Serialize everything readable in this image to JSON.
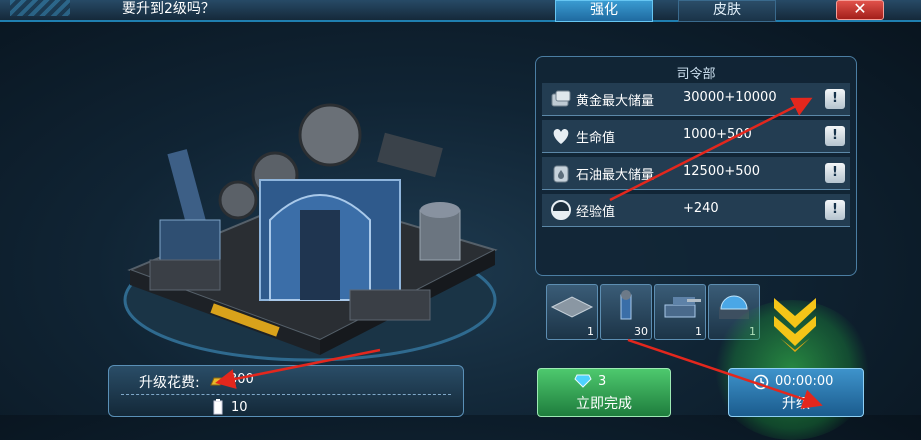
{
  "header": {
    "title": "要升到2级吗？",
    "tabs": [
      {
        "label": "强化",
        "active": true
      },
      {
        "label": "皮肤",
        "active": false
      }
    ],
    "close_icon": "close-x-icon"
  },
  "stats": {
    "panel_title": "司令部",
    "rows": [
      {
        "icon": "gold-storage-icon",
        "name": "黄金最大储量",
        "value": "30000+10000"
      },
      {
        "icon": "heart-icon",
        "name": "生命值",
        "value": "1000+500"
      },
      {
        "icon": "oil-storage-icon",
        "name": "石油最大储量",
        "value": "12500+500"
      },
      {
        "icon": "experience-icon",
        "name": "经验值",
        "value": "+240"
      }
    ],
    "info_glyph": "!"
  },
  "unlocks": [
    {
      "icon": "floor-tile-icon",
      "count": "1"
    },
    {
      "icon": "tower-unit-icon",
      "count": "30"
    },
    {
      "icon": "tank-turret-icon",
      "count": "1"
    },
    {
      "icon": "domed-building-icon",
      "count": "1"
    }
  ],
  "cost": {
    "label": "升级花费:",
    "gold_amount": "300",
    "battery_amount": "10"
  },
  "actions": {
    "instant": {
      "gem_cost": "3",
      "label": "立即完成"
    },
    "upgrade": {
      "time": "00:00:00",
      "label": "升级"
    }
  },
  "colors": {
    "accent_blue": "#3a9bd1",
    "annotation_red": "#e3271d",
    "instant_green": "#2fa64f",
    "highlight_yellow": "#f5c518"
  }
}
